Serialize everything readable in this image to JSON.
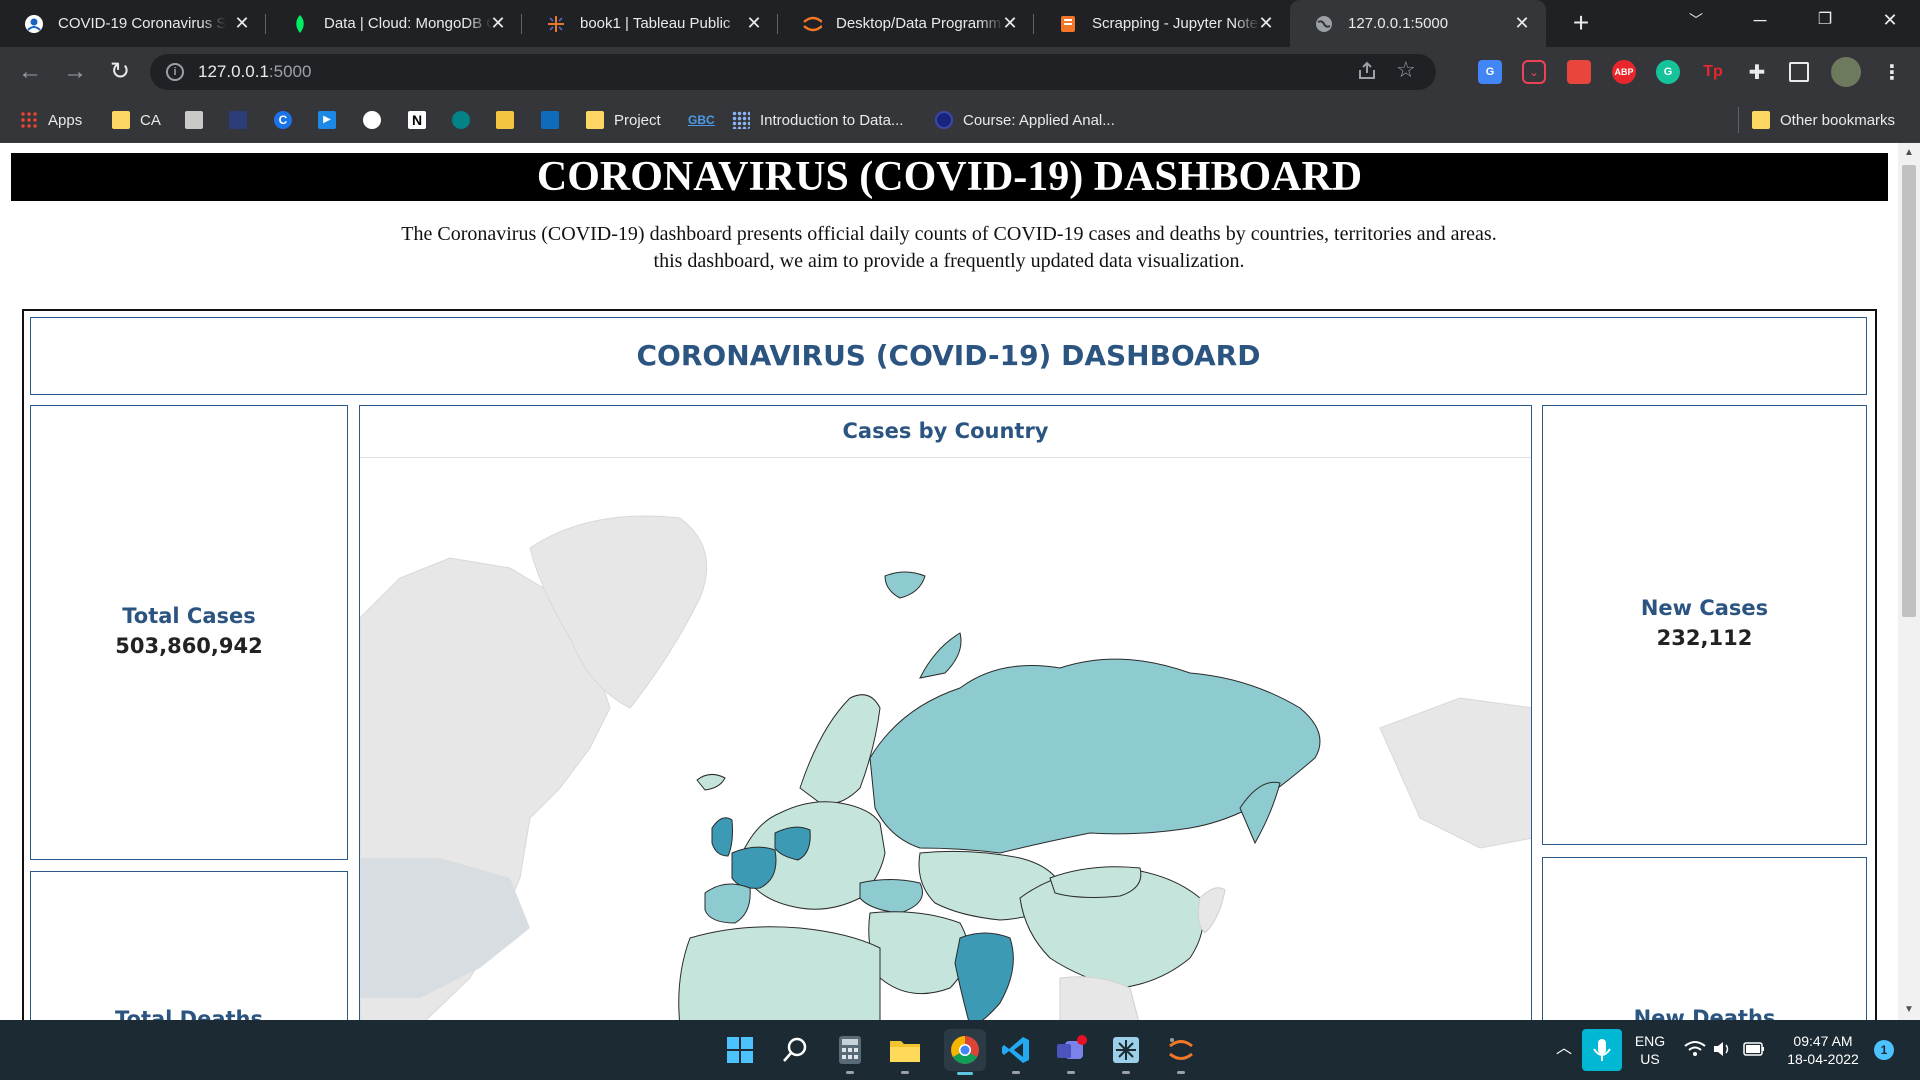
{
  "browser": {
    "tabs": [
      {
        "title": "COVID-19 Coronavirus St",
        "favicon": "coronavirus-icon",
        "active": false
      },
      {
        "title": "Data | Cloud: MongoDB C",
        "favicon": "mongodb-leaf-icon",
        "active": false
      },
      {
        "title": "book1 | Tableau Public",
        "favicon": "tableau-icon",
        "active": false
      },
      {
        "title": "Desktop/Data Programm",
        "favicon": "jupyter-icon",
        "active": false
      },
      {
        "title": "Scrapping - Jupyter Note",
        "favicon": "notebook-icon",
        "active": false
      },
      {
        "title": "127.0.0.1:5000",
        "favicon": "globe-icon",
        "active": true
      }
    ],
    "new_tab_glyph": "+",
    "address": {
      "host": "127.0.0.1",
      "port": ":5000"
    },
    "extensions": [
      "google-translate-icon",
      "pocket-icon",
      "bookmark-red-icon",
      "adblock-plus-icon",
      "grammarly-icon",
      "tp-icon",
      "puzzle-icon",
      "sidebar-icon",
      "profile-avatar"
    ],
    "extension_labels": {
      "abp": "ABP",
      "tp": "Tp",
      "g": "G",
      "gt": "G"
    },
    "bookmarks": [
      {
        "label": "Apps",
        "icon": "apps-grid-icon"
      },
      {
        "label": "CA",
        "icon": "folder-icon"
      },
      {
        "label": "",
        "icon": "doc-icon"
      },
      {
        "label": "",
        "icon": "blue-square-icon"
      },
      {
        "label": "",
        "icon": "c-logo-icon"
      },
      {
        "label": "",
        "icon": "play-icon"
      },
      {
        "label": "",
        "icon": "github-icon"
      },
      {
        "label": "",
        "icon": "notion-icon"
      },
      {
        "label": "",
        "icon": "sharepoint-icon"
      },
      {
        "label": "",
        "icon": "pencil-icon"
      },
      {
        "label": "",
        "icon": "outlook-icon"
      },
      {
        "label": "Project",
        "icon": "folder-icon"
      },
      {
        "label": "",
        "icon": "gbc-icon"
      },
      {
        "label": "Introduction to Data...",
        "icon": "dots-icon"
      },
      {
        "label": "Course: Applied Anal...",
        "icon": "circle-icon"
      }
    ],
    "notion_letter": "N",
    "gbc_text": "GBC",
    "c_letter": "C",
    "other_bookmarks": "Other bookmarks"
  },
  "page": {
    "header": "CORONAVIRUS (COVID-19) DASHBOARD",
    "intro_line1": "The Coronavirus (COVID-19) dashboard presents official daily counts of COVID-19 cases and deaths by countries, territories and areas.",
    "intro_line2": "this dashboard, we aim to provide a frequently updated data visualization.",
    "dashboard": {
      "title": "CORONAVIRUS (COVID-19) DASHBOARD",
      "total_cases_label": "Total Cases",
      "total_cases_value": "503,860,942",
      "new_cases_label": "New Cases",
      "new_cases_value": "232,112",
      "total_deaths_label": "Total Deaths",
      "new_deaths_label": "New Deaths",
      "map_title": "Cases by Country",
      "colors": {
        "title": "#2b5580",
        "border": "#2c5a8a",
        "map_light": "#c4e4dc",
        "map_mid": "#8ecbd0",
        "map_dark": "#3d9ab4",
        "map_base": "#e7e7e7"
      }
    }
  },
  "taskbar": {
    "apps": [
      "windows-start-icon",
      "search-icon",
      "calculator-icon",
      "file-explorer-icon",
      "chrome-icon",
      "vscode-icon",
      "teams-icon",
      "snipping-icon",
      "jupyter-icon"
    ],
    "lang_top": "ENG",
    "lang_bottom": "US",
    "time": "09:47 AM",
    "date": "18-04-2022",
    "notification_count": "1"
  }
}
